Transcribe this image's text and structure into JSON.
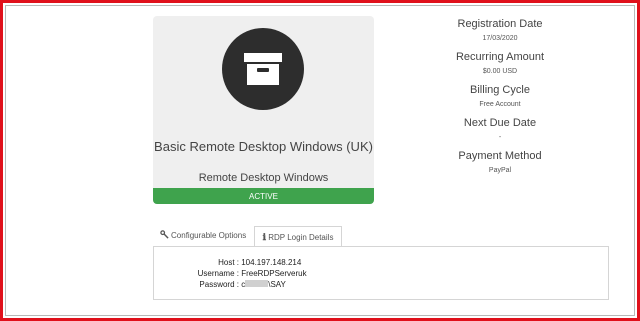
{
  "product": {
    "name": "Basic Remote Desktop Windows (UK)",
    "group": "Remote Desktop Windows",
    "status": "ACTIVE",
    "icon": "archive-box-icon"
  },
  "info": [
    {
      "label": "Registration Date",
      "value": "17/03/2020"
    },
    {
      "label": "Recurring Amount",
      "value": "$0.00 USD"
    },
    {
      "label": "Billing Cycle",
      "value": "Free Account"
    },
    {
      "label": "Next Due Date",
      "value": "-"
    },
    {
      "label": "Payment Method",
      "value": "PayPal"
    }
  ],
  "tabs": {
    "configurable_options": "Configurable Options",
    "rdp_login_details": "RDP Login Details"
  },
  "login": {
    "host_label": "Host :",
    "host_value": "104.197.148.214",
    "username_label": "Username :",
    "username_value": "FreeRDPServeruk",
    "password_label": "Password :",
    "password_prefix": "c",
    "password_suffix": "\\SAY"
  },
  "colors": {
    "border": "#e0101b",
    "status_bg": "#3fa34d",
    "icon_circle": "#2d2d2d",
    "card_bg": "#efefef"
  }
}
